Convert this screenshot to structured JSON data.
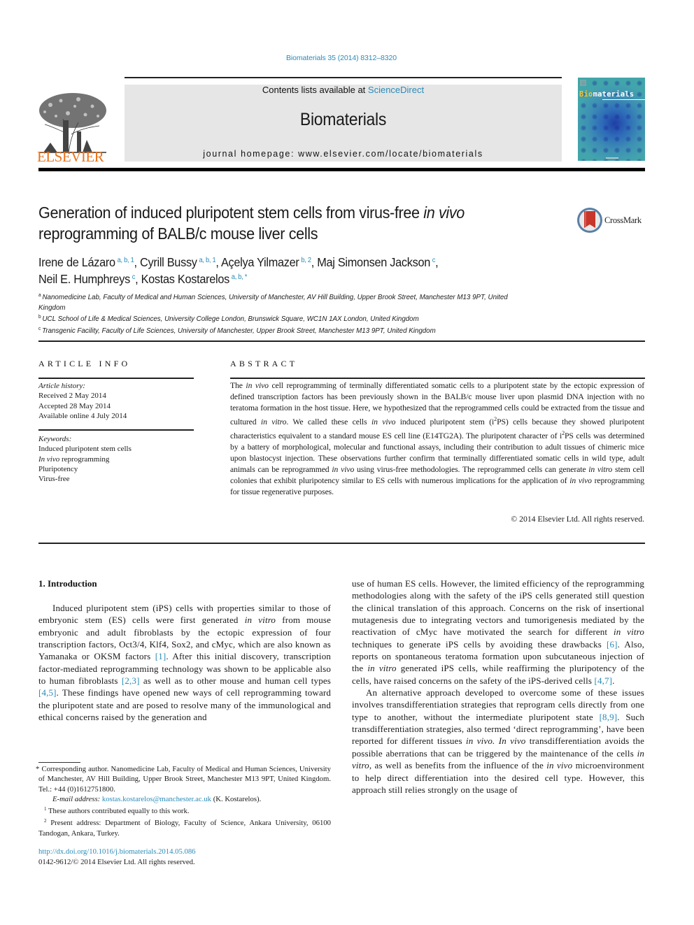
{
  "header": {
    "citation": "Biomaterials 35 (2014) 8312–8320",
    "publisher_logo_word": "ELSEVIER",
    "contents_prefix": "Contents lists available at ",
    "contents_link": "ScienceDirect",
    "journal_title": "Biomaterials",
    "homepage_label": "journal homepage: www.elsevier.com/locate/biomaterials",
    "cover": {
      "title_highlight": "Bio",
      "title_rest": "materials"
    },
    "colors": {
      "link": "#2a8bb8",
      "elsevier_orange": "#e8731c",
      "banner_bg": "#e6e6e6"
    }
  },
  "article": {
    "title_part1": "Generation of induced pluripotent stem cells from virus-free ",
    "title_italic": "in vivo",
    "title_part2": "reprogramming of BALB/c mouse liver cells",
    "crossmark_label": "CrossMark",
    "authors": [
      {
        "name": "Irene de Lázaro",
        "sup": "a, b, 1",
        "sep": ", "
      },
      {
        "name": "Cyrill Bussy",
        "sup": "a, b, 1",
        "sep": ", "
      },
      {
        "name": "Açelya Yilmazer",
        "sup": "b, 2",
        "sep": ", "
      },
      {
        "name": "Maj Simonsen Jackson",
        "sup": "c",
        "sep": ","
      },
      {
        "name": "Neil E. Humphreys",
        "sup": "c",
        "sep": ", "
      },
      {
        "name": "Kostas Kostarelos",
        "sup": "a, b, *",
        "sep": ""
      }
    ],
    "affiliations": [
      {
        "key": "a",
        "text": "Nanomedicine Lab, Faculty of Medical and Human Sciences, University of Manchester, AV Hill Building, Upper Brook Street, Manchester M13 9PT, United Kingdom"
      },
      {
        "key": "b",
        "text": "UCL School of Life & Medical Sciences, University College London, Brunswick Square, WC1N 1AX London, United Kingdom"
      },
      {
        "key": "c",
        "text": "Transgenic Facility, Faculty of Life Sciences, University of Manchester, Upper Brook Street, Manchester M13 9PT, United Kingdom"
      }
    ]
  },
  "article_info": {
    "heading": "ARTICLE INFO",
    "history_label": "Article history:",
    "history": [
      "Received 2 May 2014",
      "Accepted 28 May 2014",
      "Available online 4 July 2014"
    ],
    "keywords_label": "Keywords:",
    "keywords": [
      {
        "italic": "",
        "text": "Induced pluripotent stem cells"
      },
      {
        "italic": "In vivo",
        "text": " reprogramming"
      },
      {
        "italic": "",
        "text": "Pluripotency"
      },
      {
        "italic": "",
        "text": "Virus-free"
      }
    ]
  },
  "abstract": {
    "heading": "ABSTRACT",
    "segments": [
      {
        "t": "The "
      },
      {
        "i": "in vivo"
      },
      {
        "t": " cell reprogramming of terminally differentiated somatic cells to a pluripotent state by the ectopic expression of defined transcription factors has been previously shown in the BALB/c mouse liver upon plasmid DNA injection with no teratoma formation in the host tissue. Here, we hypothesized that the reprogrammed cells could be extracted from the tissue and cultured "
      },
      {
        "i": "in vitro"
      },
      {
        "t": ". We called these cells "
      },
      {
        "i": "in vivo"
      },
      {
        "t": " induced pluripotent stem (i"
      },
      {
        "sup": "2"
      },
      {
        "t": "PS) cells because they showed pluripotent characteristics equivalent to a standard mouse ES cell line (E14TG2A). The pluripotent character of i"
      },
      {
        "sup": "2"
      },
      {
        "t": "PS cells was determined by a battery of morphological, molecular and functional assays, including their contribution to adult tissues of chimeric mice upon blastocyst injection. These observations further confirm that terminally differentiated somatic cells in wild type, adult animals can be reprogrammed "
      },
      {
        "i": "in vivo"
      },
      {
        "t": " using virus-free methodologies. The reprogrammed cells can generate "
      },
      {
        "i": "in vitro"
      },
      {
        "t": " stem cell colonies that exhibit pluripotency similar to ES cells with numerous implications for the application of "
      },
      {
        "i": "in vivo"
      },
      {
        "t": " reprogramming for tissue regenerative purposes."
      }
    ],
    "copyright": "© 2014 Elsevier Ltd. All rights reserved."
  },
  "body": {
    "section_heading": "1.  Introduction",
    "left_paragraphs": [
      [
        {
          "t": "Induced pluripotent stem (iPS) cells with properties similar to those of embryonic stem (ES) cells were first generated "
        },
        {
          "i": "in vitro"
        },
        {
          "t": " from mouse embryonic and adult fibroblasts by the ectopic expression of four transcription factors, Oct3/4, Klf4, Sox2, and cMyc, which are also known as Yamanaka or OKSM factors "
        },
        {
          "ref": "[1]"
        },
        {
          "t": ". After this initial discovery, transcription factor-mediated reprogramming technology was shown to be applicable also to human fibroblasts "
        },
        {
          "ref": "[2,3]"
        },
        {
          "t": " as well as to other mouse and human cell types "
        },
        {
          "ref": "[4,5]"
        },
        {
          "t": ". These findings have opened new ways of cell reprogramming toward the pluripotent state and are posed to resolve many of the immunological and ethical concerns raised by the generation and"
        }
      ]
    ],
    "right_paragraphs": [
      [
        {
          "t": "use of human ES cells. However, the limited efficiency of the reprogramming methodologies along with the safety of the iPS cells generated still question the clinical translation of this approach. Concerns on the risk of insertional mutagenesis due to integrating vectors and tumorigenesis mediated by the reactivation of cMyc have motivated the search for different "
        },
        {
          "i": "in vitro"
        },
        {
          "t": " techniques to generate iPS cells by avoiding these drawbacks "
        },
        {
          "ref": "[6]"
        },
        {
          "t": ". Also, reports on spontaneous teratoma formation upon subcutaneous injection of the "
        },
        {
          "i": "in vitro"
        },
        {
          "t": " generated iPS cells, while reaffirming the pluripotency of the cells, have raised concerns on the safety of the iPS-derived cells "
        },
        {
          "ref": "[4,7]"
        },
        {
          "t": "."
        }
      ],
      [
        {
          "t": "An alternative approach developed to overcome some of these issues involves transdifferentiation strategies that reprogram cells directly from one type to another, without the intermediate pluripotent state "
        },
        {
          "ref": "[8,9]"
        },
        {
          "t": ". Such transdifferentiation strategies, also termed ‘direct reprogramming’, have been reported for different tissues "
        },
        {
          "i": "in vivo. In vivo"
        },
        {
          "t": " transdifferentiation avoids the possible aberrations that can be triggered by the maintenance of the cells "
        },
        {
          "i": "in vitro"
        },
        {
          "t": ", as well as benefits from the influence of the "
        },
        {
          "i": "in vivo"
        },
        {
          "t": " microenvironment to help direct differentiation into the desired cell type. However, this approach still relies strongly on the usage of"
        }
      ]
    ]
  },
  "footnotes": {
    "corresponding": "* Corresponding author. Nanomedicine Lab, Faculty of Medical and Human Sciences, University of Manchester, AV Hill Building, Upper Brook Street, Manchester M13 9PT, United Kingdom. Tel.: +44 (0)1612751800.",
    "email_label": "E-mail address: ",
    "email": "kostas.kostarelos@manchester.ac.uk",
    "email_suffix": " (K. Kostarelos).",
    "note1_key": "1",
    "note1": " These authors contributed equally to this work.",
    "note2_key": "2",
    "note2": " Present address: Department of Biology, Faculty of Science, Ankara University, 06100 Tandogan, Ankara, Turkey.",
    "doi": "http://dx.doi.org/10.1016/j.biomaterials.2014.05.086",
    "issn": "0142-9612/© 2014 Elsevier Ltd. All rights reserved."
  }
}
